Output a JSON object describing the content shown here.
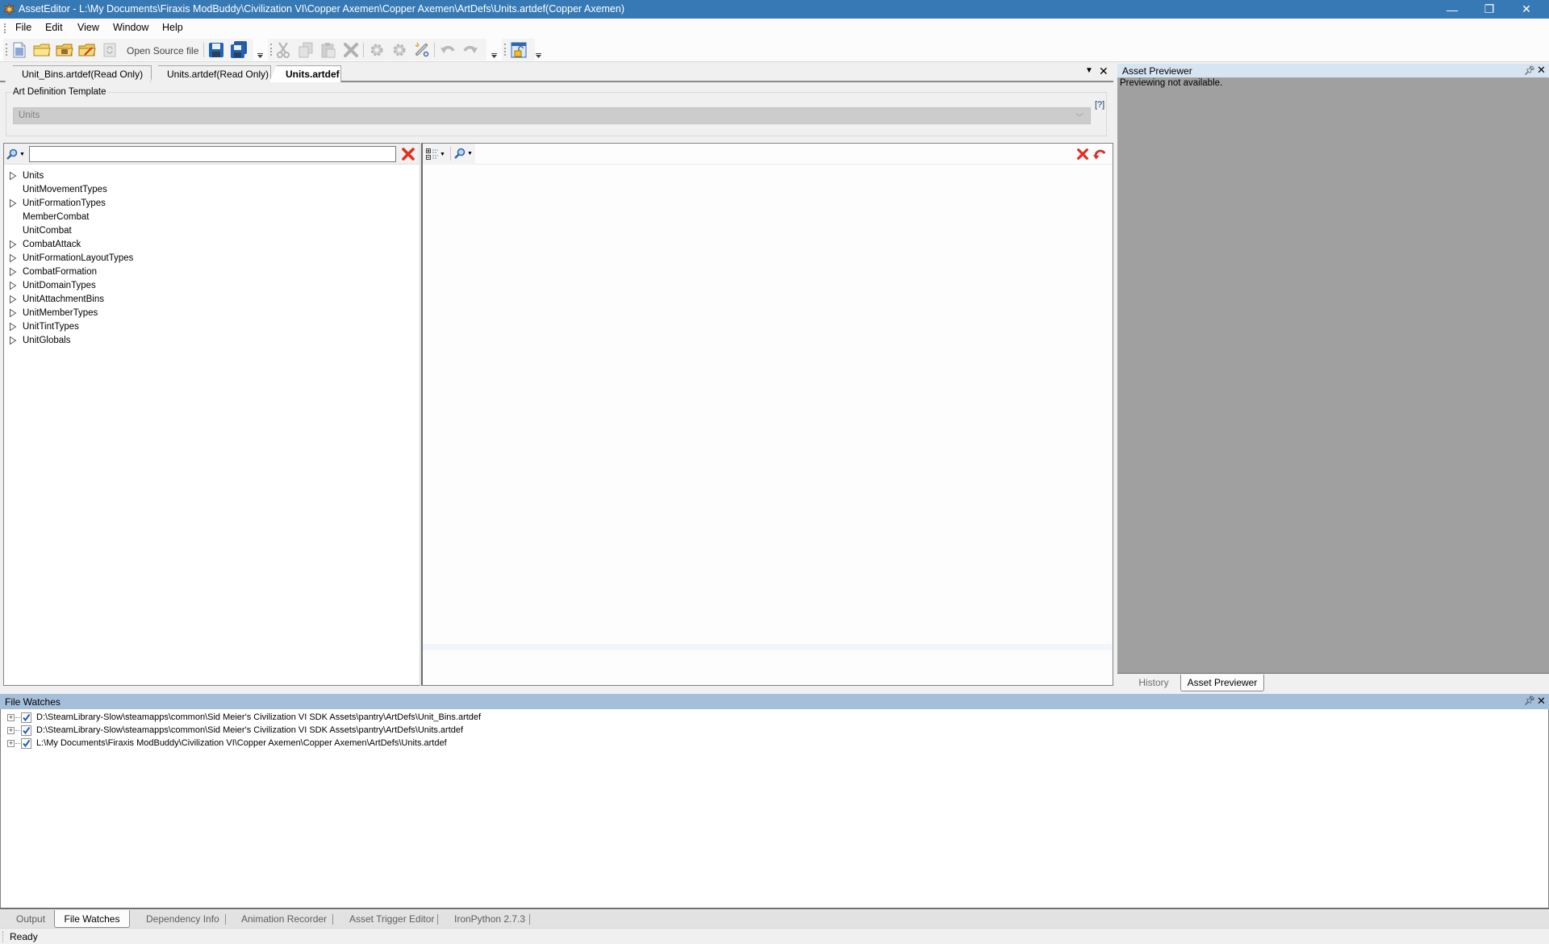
{
  "window": {
    "title": "AssetEditor - L:\\My Documents\\Firaxis ModBuddy\\Civilization VI\\Copper Axemen\\Copper Axemen\\ArtDefs\\Units.artdef(Copper Axemen)",
    "app_icon": "asset-editor-icon",
    "controls": {
      "minimize": "—",
      "restore": "❐",
      "close": "✕"
    }
  },
  "menu": {
    "items": [
      "File",
      "Edit",
      "View",
      "Window",
      "Help"
    ]
  },
  "toolbar": {
    "open_source_label": "Open Source file",
    "buttons": [
      {
        "name": "new-file",
        "icon": "new-document-icon",
        "enabled": true
      },
      {
        "name": "open-folder",
        "icon": "folder-icon",
        "enabled": true
      },
      {
        "name": "open-asset",
        "icon": "folder-asset-icon",
        "enabled": true
      },
      {
        "name": "open-recent",
        "icon": "folder-edit-icon",
        "enabled": true
      },
      {
        "name": "refresh",
        "icon": "refresh-icon",
        "enabled": false
      },
      {
        "name": "save",
        "icon": "save-icon",
        "enabled": true
      },
      {
        "name": "save-all",
        "icon": "save-all-icon",
        "enabled": true
      },
      {
        "name": "cut",
        "icon": "scissors-icon",
        "enabled": false
      },
      {
        "name": "copy",
        "icon": "copy-icon",
        "enabled": false
      },
      {
        "name": "paste",
        "icon": "paste-icon",
        "enabled": false
      },
      {
        "name": "delete",
        "icon": "delete-icon",
        "enabled": false
      },
      {
        "name": "build",
        "icon": "gear-icon",
        "enabled": false
      },
      {
        "name": "build-all",
        "icon": "gear-icon",
        "enabled": false
      },
      {
        "name": "dependencies",
        "icon": "link-search-icon",
        "enabled": true
      },
      {
        "name": "undo",
        "icon": "undo-icon",
        "enabled": false
      },
      {
        "name": "redo",
        "icon": "redo-icon",
        "enabled": false
      },
      {
        "name": "checkout",
        "icon": "unlock-window-icon",
        "enabled": true
      }
    ]
  },
  "doc_tabs": [
    {
      "label": "Unit_Bins.artdef(Read Only)",
      "active": false
    },
    {
      "label": "Units.artdef(Read Only)",
      "active": false
    },
    {
      "label": "Units.artdef",
      "active": true
    }
  ],
  "template": {
    "legend": "Art Definition Template",
    "selected": "Units",
    "help": "[?]"
  },
  "tree": {
    "search_value": "",
    "search_placeholder": "",
    "items": [
      {
        "label": "Units",
        "expandable": true
      },
      {
        "label": "UnitMovementTypes",
        "expandable": false
      },
      {
        "label": "UnitFormationTypes",
        "expandable": true
      },
      {
        "label": "MemberCombat",
        "expandable": false
      },
      {
        "label": "UnitCombat",
        "expandable": false
      },
      {
        "label": "CombatAttack",
        "expandable": true
      },
      {
        "label": "UnitFormationLayoutTypes",
        "expandable": true
      },
      {
        "label": "CombatFormation",
        "expandable": true
      },
      {
        "label": "UnitDomainTypes",
        "expandable": true
      },
      {
        "label": "UnitAttachmentBins",
        "expandable": true
      },
      {
        "label": "UnitMemberTypes",
        "expandable": true
      },
      {
        "label": "UnitTintTypes",
        "expandable": true
      },
      {
        "label": "UnitGlobals",
        "expandable": true
      }
    ]
  },
  "asset_previewer": {
    "title": "Asset Previewer",
    "message": "Previewing not available.",
    "tabs": [
      {
        "label": "History",
        "active": false
      },
      {
        "label": "Asset Previewer",
        "active": true
      }
    ]
  },
  "file_watches": {
    "title": "File Watches",
    "items": [
      {
        "path": "D:\\SteamLibrary-Slow\\steamapps\\common\\Sid Meier's Civilization VI SDK Assets\\pantry\\ArtDefs\\Unit_Bins.artdef",
        "checked": true
      },
      {
        "path": "D:\\SteamLibrary-Slow\\steamapps\\common\\Sid Meier's Civilization VI SDK Assets\\pantry\\ArtDefs\\Units.artdef",
        "checked": true
      },
      {
        "path": "L:\\My Documents\\Firaxis ModBuddy\\Civilization VI\\Copper Axemen\\Copper Axemen\\ArtDefs\\Units.artdef",
        "checked": true
      }
    ]
  },
  "bottom_tabs": [
    {
      "label": "Output",
      "active": false
    },
    {
      "label": "File Watches",
      "active": true
    },
    {
      "label": "Dependency Info",
      "active": false
    },
    {
      "label": "Animation Recorder",
      "active": false
    },
    {
      "label": "Asset Trigger Editor",
      "active": false
    },
    {
      "label": "IronPython 2.7.3",
      "active": false
    }
  ],
  "status": {
    "text": "Ready"
  },
  "colors": {
    "titlebar": "#3779b5",
    "panel_header_active": "#d7e4f2",
    "panel_header": "#a5bfdb",
    "preview_bg": "#a0a0a0",
    "danger_red": "#e0301e"
  }
}
